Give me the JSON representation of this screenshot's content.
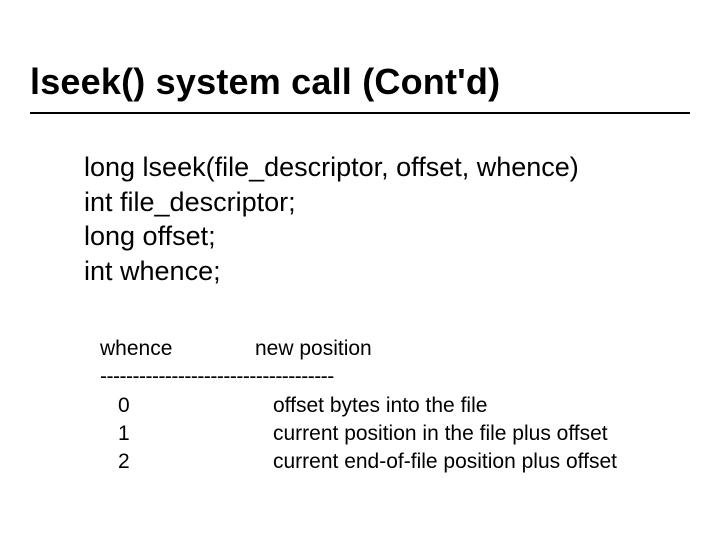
{
  "title": "lseek() system call (Cont'd)",
  "decl": {
    "line1": "long lseek(file_descriptor, offset, whence)",
    "line2": "int file_descriptor;",
    "line3": "long offset;",
    "line4": "int whence;"
  },
  "table": {
    "header_whence": "whence",
    "header_pos": "new position",
    "separator": "------------------------------------",
    "rows": [
      {
        "whence": "0",
        "pos": "offset bytes into the file"
      },
      {
        "whence": "1",
        "pos": "current position in the file plus offset"
      },
      {
        "whence": "2",
        "pos": "current end-of-file position plus offset"
      }
    ]
  }
}
